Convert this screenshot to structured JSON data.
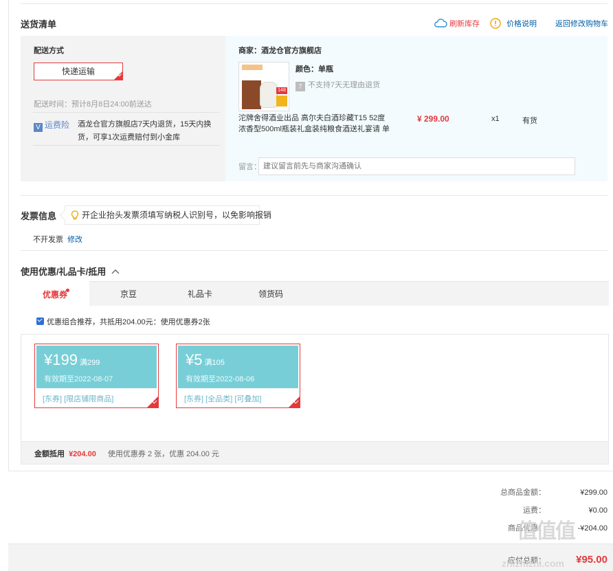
{
  "delivery": {
    "title": "送货清单",
    "refresh_label": "刷新库存",
    "price_note_label": "价格说明",
    "back_cart_label": "返回修改购物车",
    "method_title": "配送方式",
    "method_button": "快递运输",
    "time_text": "配送时间：预计8月8日24:00前送达",
    "insurance_tag": "运费险",
    "insurance_line1": "酒龙仓官方旗舰店7天内退货，15天内换",
    "insurance_line2": "货，可享1次运费赔付到小金库"
  },
  "shop": {
    "merchant": "商家：酒龙仓官方旗舰店",
    "color": "颜色：单瓶",
    "no_return": "不支持7天无理由退货",
    "product_line1": "沱牌舍得酒业出品 高尔夫白酒珍藏T15 52度",
    "product_line2": "浓香型500ml瓶装礼盒装纯粮食酒送礼宴请 单",
    "price": "¥ 299.00",
    "qty": "x1",
    "stock": "有货",
    "message_label": "留言：",
    "message_placeholder": "建议留言前先与商家沟通确认",
    "img_badge": "148"
  },
  "invoice": {
    "title": "发票信息",
    "tip": "开企业抬头发票须填写纳税人识别号，以免影响报销",
    "status": "不开发票",
    "edit": "修改"
  },
  "discount": {
    "title": "使用优惠/礼品卡/抵用",
    "tabs": [
      "优惠券",
      "京豆",
      "礼品卡",
      "领货码"
    ],
    "combo_text": "优惠组合推荐，共抵用204.00元：使用优惠券2张",
    "coupons": [
      {
        "amount": "¥199",
        "threshold": "满299",
        "expiry": "有效期至2022-08-07",
        "tags": "[东券]  [限店铺限商品]"
      },
      {
        "amount": "¥5",
        "threshold": "满105",
        "expiry": "有效期至2022-08-06",
        "tags": "[东券]  [全品类]  [可叠加]"
      }
    ],
    "sum_label": "金额抵用",
    "sum_value": "¥204.00",
    "sum_desc": "使用优惠券 2 张，优惠 204.00 元"
  },
  "summary": {
    "total_label": "总商品金额：",
    "total_value": "¥299.00",
    "freight_label": "运费：",
    "freight_value": "¥0.00",
    "deduct_label": "商品优惠：",
    "deduct_value": "-¥204.00",
    "pay_label": "应付总额：",
    "pay_value": "¥95.00"
  },
  "watermark": {
    "logo": "值",
    "url": "zhizhizhi.com"
  },
  "colors": {
    "accent_red": "#e4393c",
    "link_blue": "#005ea7",
    "coupon_teal": "#78ced7"
  }
}
